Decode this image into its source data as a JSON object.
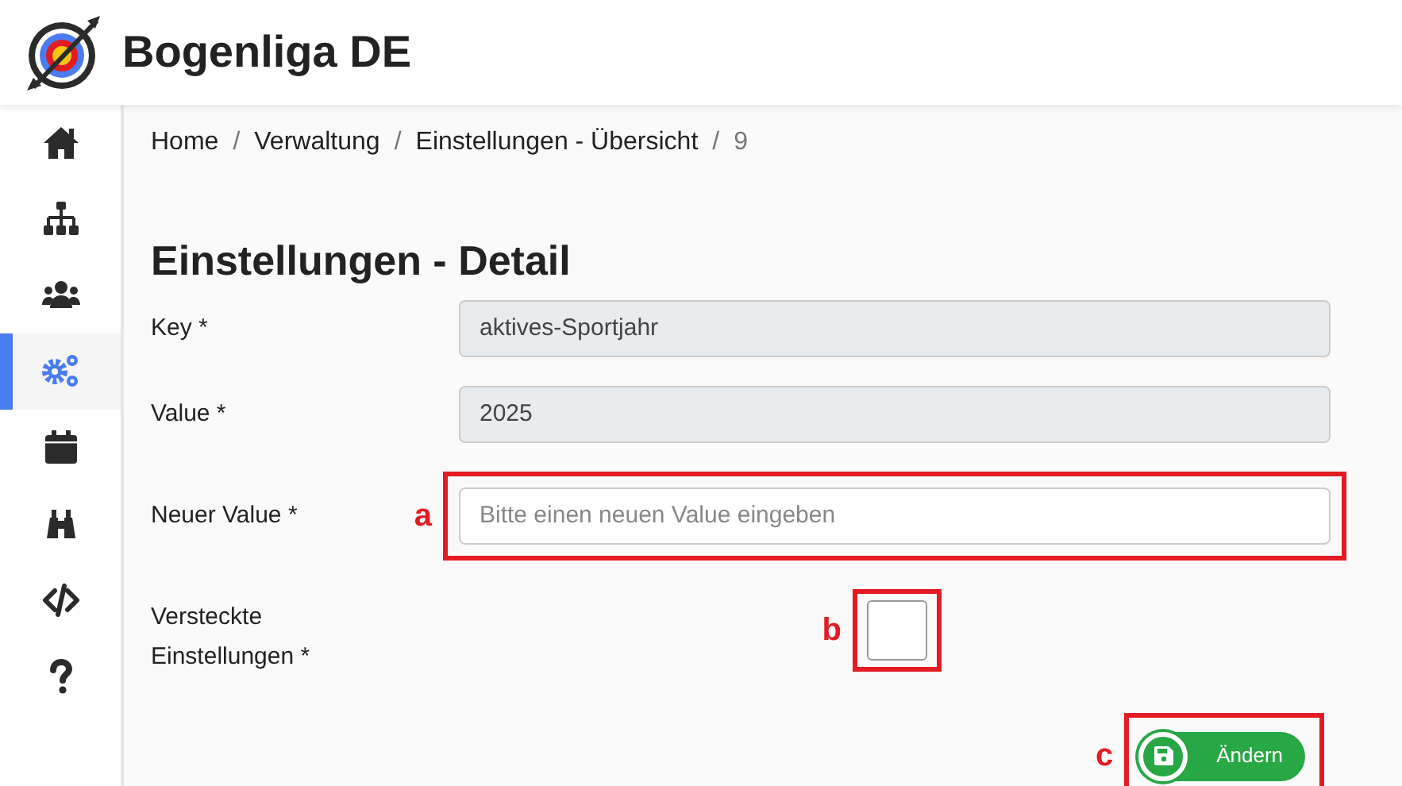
{
  "app": {
    "title": "Bogenliga DE"
  },
  "sidebar": {
    "items": [
      {
        "selected": false
      },
      {
        "selected": false
      },
      {
        "selected": false
      },
      {
        "selected": true
      },
      {
        "selected": false
      },
      {
        "selected": false
      },
      {
        "selected": false
      },
      {
        "selected": false
      }
    ]
  },
  "breadcrumb_separator": "/",
  "breadcrumb": [
    {
      "label": "Home",
      "active": false
    },
    {
      "label": "Verwaltung",
      "active": false
    },
    {
      "label": "Einstellungen - Übersicht",
      "active": false
    },
    {
      "label": "9",
      "active": true
    }
  ],
  "page_title": "Einstellungen - Detail",
  "form": {
    "fields": [
      {
        "kind": "text",
        "label": "Key *",
        "value": "aktives-Sportjahr",
        "disabled": true
      },
      {
        "kind": "text",
        "label": "Value *",
        "value": "2025",
        "disabled": true
      },
      {
        "kind": "text",
        "label": "Neuer Value *",
        "placeholder": "Bitte einen neuen Value eingeben",
        "disabled": false,
        "annotation": "a"
      },
      {
        "kind": "checkbox",
        "label": "Versteckte Einstellungen *",
        "checked": false,
        "annotation": "b"
      }
    ],
    "submit": {
      "label": "Ändern",
      "annotation": "c"
    }
  }
}
